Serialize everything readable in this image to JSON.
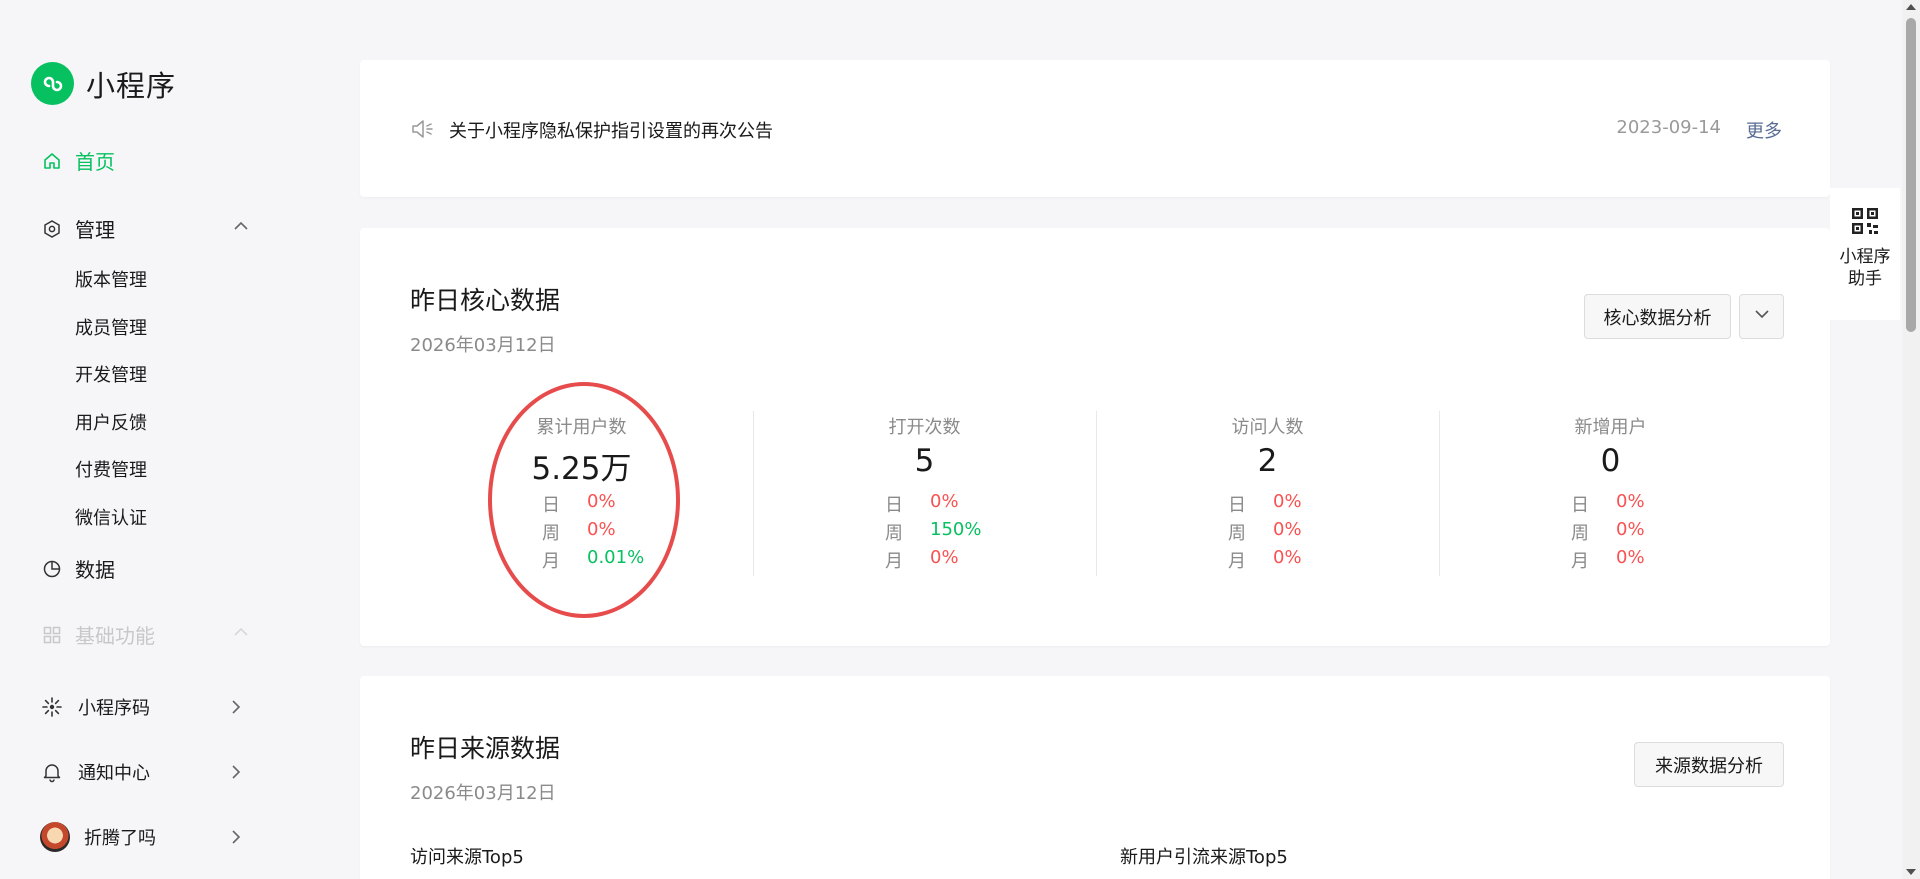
{
  "app": {
    "name": "小程序"
  },
  "sidebar": {
    "home": "首页",
    "manage": "管理",
    "manage_items": [
      "版本管理",
      "成员管理",
      "开发管理",
      "用户反馈",
      "付费管理",
      "微信认证"
    ],
    "data": "数据",
    "basic": "基础功能",
    "bottom": {
      "qrcode": "小程序码",
      "notify": "通知中心",
      "account": "折腾了吗"
    }
  },
  "notice": {
    "text": "关于小程序隐私保护指引设置的再次公告",
    "date": "2023-09-14",
    "more": "更多"
  },
  "core": {
    "title": "昨日核心数据",
    "date": "2026年03月12日",
    "analysis_button": "核心数据分析",
    "period_labels": {
      "day": "日",
      "week": "周",
      "month": "月"
    },
    "stats": [
      {
        "label": "累计用户数",
        "value": "5.25万",
        "day": "0%",
        "week": "0%",
        "month": "0.01%"
      },
      {
        "label": "打开次数",
        "value": "5",
        "day": "0%",
        "week": "150%",
        "month": "0%"
      },
      {
        "label": "访问人数",
        "value": "2",
        "day": "0%",
        "week": "0%",
        "month": "0%"
      },
      {
        "label": "新增用户",
        "value": "0",
        "day": "0%",
        "week": "0%",
        "month": "0%"
      }
    ]
  },
  "source": {
    "title": "昨日来源数据",
    "date": "2026年03月12日",
    "analysis_button": "来源数据分析",
    "left_title": "访问来源Top5",
    "right_title": "新用户引流来源Top5"
  },
  "helper": {
    "label_line1": "小程序",
    "label_line2": "助手"
  },
  "colors": {
    "brand": "#07c160",
    "down": "#fa5151",
    "link": "#576b95",
    "highlight_circle": "#e74c4c"
  }
}
